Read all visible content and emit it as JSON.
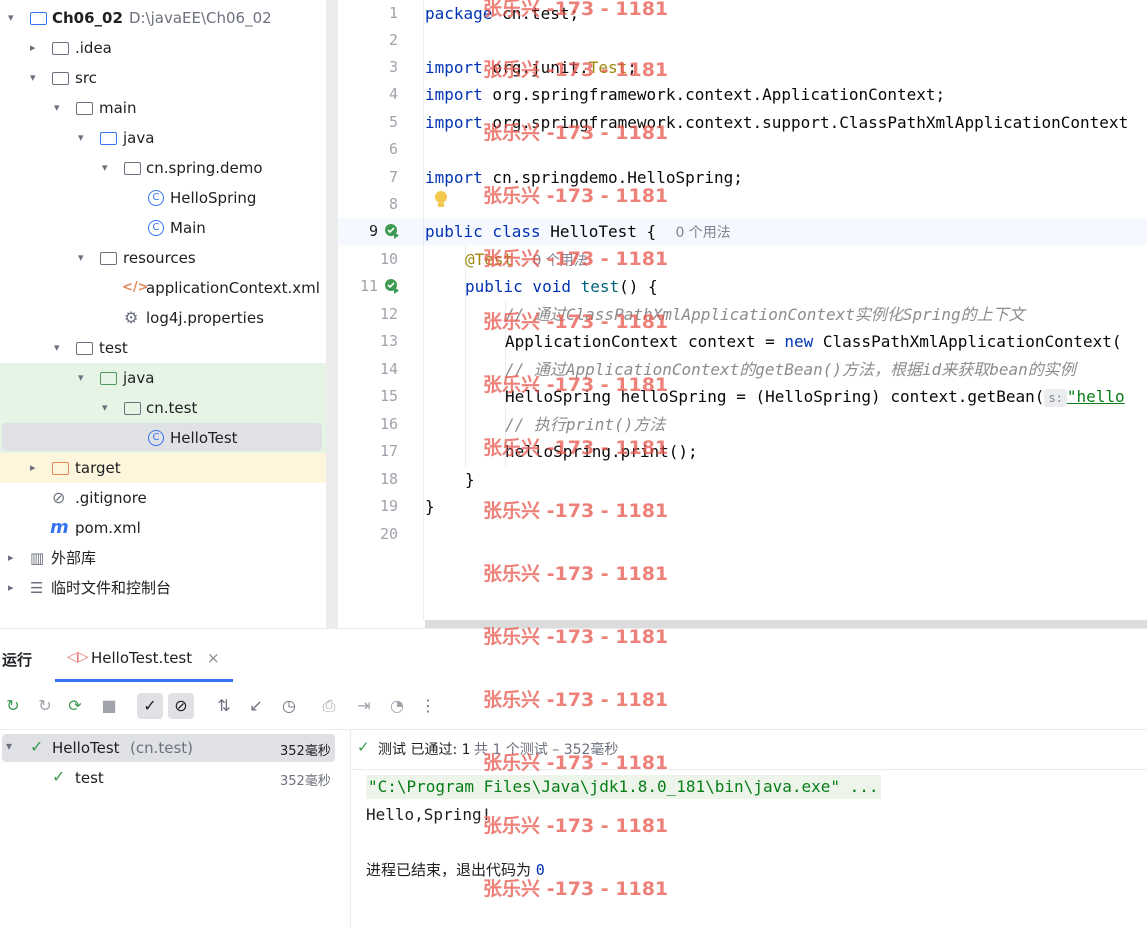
{
  "project_tree": {
    "root": {
      "name": "Ch06_02",
      "path": "D:\\javaEE\\Ch06_02"
    },
    "items": [
      {
        "label": "Ch06_02"
      },
      {
        "label": ".idea"
      },
      {
        "label": "src"
      },
      {
        "label": "main"
      },
      {
        "label": "java"
      },
      {
        "label": "cn.spring.demo"
      },
      {
        "label": "HelloSpring"
      },
      {
        "label": "Main"
      },
      {
        "label": "resources"
      },
      {
        "label": "applicationContext.xml"
      },
      {
        "label": "log4j.properties"
      },
      {
        "label": "test"
      },
      {
        "label": "java"
      },
      {
        "label": "cn.test"
      },
      {
        "label": "HelloTest"
      },
      {
        "label": "target"
      },
      {
        "label": ".gitignore"
      },
      {
        "label": "pom.xml"
      },
      {
        "label": "外部库"
      },
      {
        "label": "临时文件和控制台"
      }
    ]
  },
  "editor": {
    "line_numbers": [
      "1",
      "2",
      "3",
      "4",
      "5",
      "6",
      "7",
      "8",
      "9",
      "10",
      "11",
      "12",
      "13",
      "14",
      "15",
      "16",
      "17",
      "18",
      "19",
      "20"
    ],
    "code": {
      "l1_kw": "package",
      "l1_rest": " cn.test;",
      "l3_kw": "import",
      "l3_rest": " org.junit.",
      "l3_ann": "Test",
      "l3_end": ";",
      "l4_kw": "import",
      "l4_rest": " org.springframework.context.ApplicationContext;",
      "l5_kw": "import",
      "l5_rest": " org.springframework.context.support.ClassPathXmlApplicationContext",
      "l7_kw": "import",
      "l7_rest": " cn.springdemo.HelloSpring;",
      "l9_kw": "public class",
      "l9_rest": " HelloTest {",
      "l9_hint": "0 个用法",
      "l10_ann": "@Test",
      "l10_hint": "0 个用法",
      "l11_kw": "public void",
      "l11_fn": "test",
      "l11_rest": "() {",
      "l12_cm": "// 通过ClassPathXmlApplicationContext实例化Spring的上下文",
      "l13_rest": "ApplicationContext context = ",
      "l13_kw": "new",
      "l13_end": " ClassPathXmlApplicationContext(",
      "l14_cm": "// 通过ApplicationContext的getBean()方法，根据id来获取bean的实例",
      "l15_rest": "HelloSpring helloSpring = (HelloSpring) context.getBean(",
      "l15_param": "s:",
      "l15_str": "\"hello",
      "l16_cm": "// 执行print()方法",
      "l17_rest": "helloSpring.print();",
      "l18_rest": "}",
      "l19_rest": "}"
    }
  },
  "run_panel": {
    "label": "运行",
    "tab": "HelloTest.test",
    "close": "×",
    "toolbar_more": "⋮",
    "test_tree": [
      {
        "name": "HelloTest",
        "pkg": "(cn.test)",
        "time": "352毫秒"
      },
      {
        "name": "test",
        "time": "352毫秒"
      }
    ],
    "status": {
      "prefix": "测试 已通过: 1",
      "suffix": "共 1 个测试 – 352毫秒"
    },
    "console": {
      "cmd": "\"C:\\Program Files\\Java\\jdk1.8.0_181\\bin\\java.exe\" ...",
      "output": "Hello,Spring!",
      "exit_label": "进程已结束，退出代码为",
      "exit_code": "0"
    }
  },
  "watermark": "张乐兴 -173 - 1181",
  "colors": {
    "keyword": "#0033b3",
    "string": "#067d17",
    "comment": "#8c8c8c",
    "annotation": "#9e880d",
    "pass": "#3d9a50",
    "watermark": "#e8574d"
  }
}
